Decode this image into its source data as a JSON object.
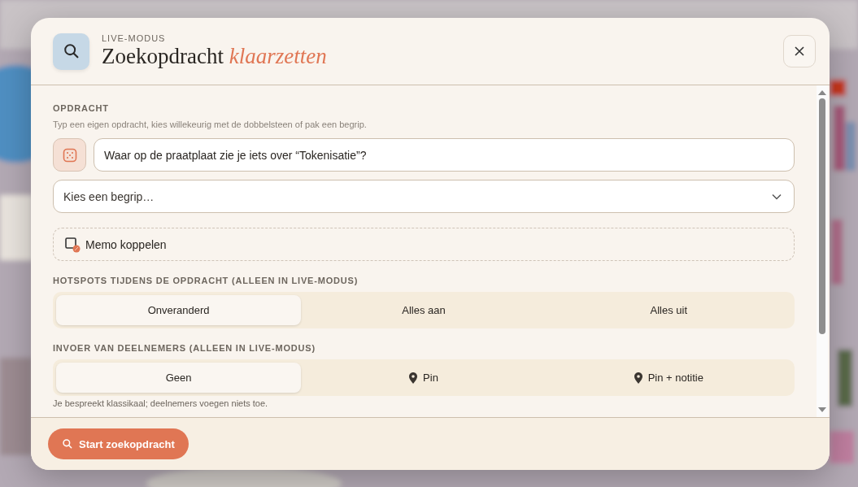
{
  "header": {
    "eyebrow": "LIVE-MODUS",
    "title": "Zoekopdracht *klaarzetten*"
  },
  "task": {
    "heading": "OPDRACHT",
    "hint": "Typ een eigen opdracht, kies willekeurig met de dobbelsteen of pak een begrip.",
    "prompt_value": "Waar op de praatplaat zie je iets over “Tokenisatie”?",
    "concept_select": {
      "placeholder": "Kies een begrip…"
    },
    "memo_button": "Memo koppelen"
  },
  "hotspots": {
    "heading": "HOTSPOTS TIJDENS DE OPDRACHT (ALLEEN IN LIVE-MODUS)",
    "options": [
      {
        "label": "Onveranderd",
        "selected": true
      },
      {
        "label": "Alles aan",
        "selected": false
      },
      {
        "label": "Alles uit",
        "selected": false
      }
    ]
  },
  "participant_input": {
    "heading": "INVOER VAN DEELNEMERS (ALLEEN IN LIVE-MODUS)",
    "options": [
      {
        "label": "Geen",
        "kind": "plain",
        "selected": true
      },
      {
        "label": "Pin",
        "kind": "pin",
        "selected": false
      },
      {
        "label": "Pin + notitie",
        "kind": "pin",
        "selected": false
      }
    ],
    "note": "Je bespreekt klassikaal; deelnemers voegen niets toe."
  },
  "footer": {
    "start_button": "Start zoekopdracht"
  }
}
